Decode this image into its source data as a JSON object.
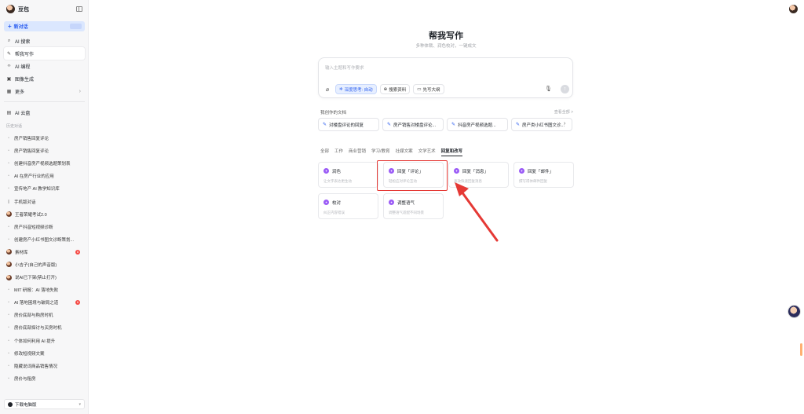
{
  "sidebar": {
    "brand": "豆包",
    "new_chat": "新对话",
    "nav": [
      {
        "label": "AI 搜索",
        "icon": "search-icon"
      },
      {
        "label": "帮我写作",
        "icon": "pen-icon",
        "active": true
      },
      {
        "label": "AI 编程",
        "icon": "code-icon"
      },
      {
        "label": "图像生成",
        "icon": "image-icon"
      },
      {
        "label": "更多",
        "icon": "grid-icon"
      }
    ],
    "cloud": "AI 云盘",
    "history_title": "历史对话",
    "history": [
      {
        "label": "房产销售回复评论"
      },
      {
        "label": "房产销售回复评论"
      },
      {
        "label": "创建抖音房产视频选题策划表"
      },
      {
        "label": "AI 在房产行业的应用"
      },
      {
        "label": "宣传地产 AI 教学知识库"
      },
      {
        "label": "手机版对话"
      },
      {
        "label": "王者荣耀考试2.0",
        "avatar": true
      },
      {
        "label": "房产抖音短视频诊断"
      },
      {
        "label": "创建房产小红书图文诊断策划..."
      },
      {
        "label": "素材库",
        "avatar": true,
        "badge": "8"
      },
      {
        "label": "小吉子(自己的声音版)",
        "avatar": true
      },
      {
        "label": "说AI已下架(禁止打开)",
        "avatar": true
      },
      {
        "label": "MIT 研报：AI 落地失败"
      },
      {
        "label": "AI 落地困境与破局之道",
        "badge": "6"
      },
      {
        "label": "房价底部与购房时机"
      },
      {
        "label": "房价底部探讨与买房时机"
      },
      {
        "label": "个体如何利用 AI 提升"
      },
      {
        "label": "修改短视频文案"
      },
      {
        "label": "隐藏说词商品销售情况"
      },
      {
        "label": "房价与租房"
      }
    ],
    "download": "下载电脑版"
  },
  "main": {
    "title": "帮我写作",
    "subtitle": "多种体裁、润色校对，一键成文",
    "input_placeholder": "输入主题和写作要求",
    "tools": {
      "deep_think": "深度思考: 自动",
      "search": "搜索资料",
      "outline": "先写大纲"
    },
    "docs_title": "我创作的文档",
    "docs_more": "查看全部 >",
    "docs": [
      "对楼盘评论的回复",
      "房产销售对楼盘评论...",
      "抖音房产视频选题...",
      "房产类小红书图文诊..."
    ],
    "tabs": [
      "全部",
      "工作",
      "商业营销",
      "学习/教育",
      "社媒文案",
      "文学艺术",
      "回复和改写"
    ],
    "active_tab": "回复和改写",
    "cards": [
      {
        "title": "润色",
        "desc": "让文字表达更生动"
      },
      {
        "title": "回复「评论」",
        "desc": "轻松应对评论互动"
      },
      {
        "title": "回复「消息」",
        "desc": "高效快速回复消息"
      },
      {
        "title": "回复「邮件」",
        "desc": "撰写得体邮件回复"
      },
      {
        "title": "校对",
        "desc": "纠正内容错误"
      },
      {
        "title": "调整语气",
        "desc": "调整语气适配不同场景"
      }
    ]
  },
  "colors": {
    "accent": "#2b5ef0",
    "card_icon": "#9b5cf6",
    "highlight": "#e53935"
  }
}
